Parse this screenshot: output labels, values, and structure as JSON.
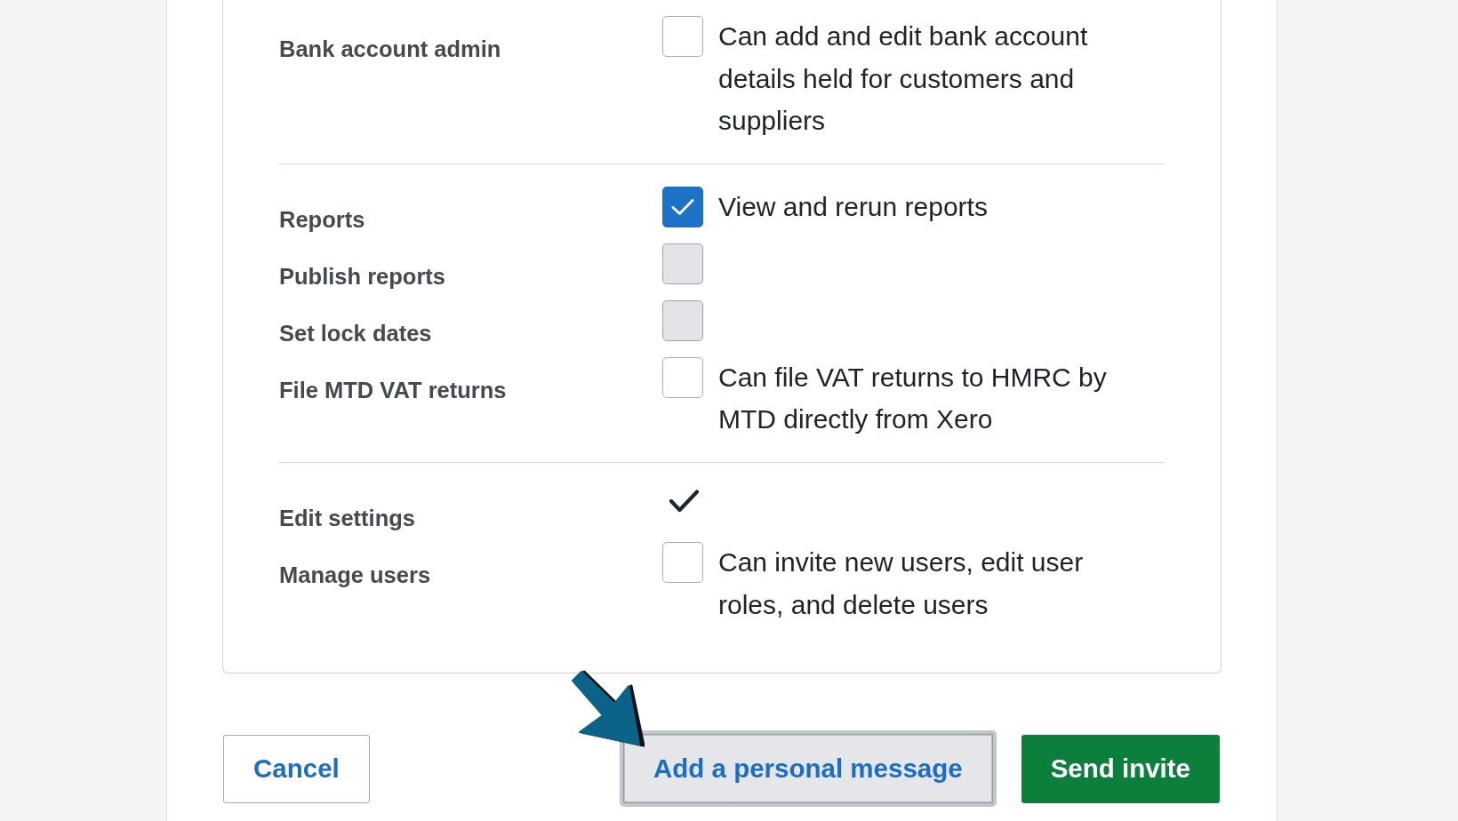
{
  "permission_groups": [
    {
      "rows": [
        {
          "label": "Bank account admin",
          "kind": "checkbox",
          "checked": false,
          "disabled": false,
          "description": "Can add and edit bank account details held for customers and suppliers"
        }
      ]
    },
    {
      "rows": [
        {
          "label": "Reports",
          "kind": "checkbox",
          "checked": true,
          "disabled": false,
          "description": "View and rerun reports"
        },
        {
          "label": "Publish reports",
          "kind": "checkbox",
          "checked": false,
          "disabled": true
        },
        {
          "label": "Set lock dates",
          "kind": "checkbox",
          "checked": false,
          "disabled": true
        },
        {
          "label": "File MTD VAT returns",
          "kind": "checkbox",
          "checked": false,
          "disabled": false,
          "description": "Can file VAT returns to HMRC by MTD directly from Xero"
        }
      ]
    },
    {
      "rows": [
        {
          "label": "Edit settings",
          "kind": "tick"
        },
        {
          "label": "Manage users",
          "kind": "checkbox",
          "checked": false,
          "disabled": false,
          "description": "Can invite new users, edit user roles, and delete users"
        }
      ]
    }
  ],
  "buttons": [
    {
      "label": "Cancel",
      "kind": "secondary",
      "focused": false
    },
    {
      "label": "Add a personal message",
      "kind": "secondary",
      "focused": true
    },
    {
      "label": "Send invite",
      "kind": "primary",
      "focused": false
    }
  ]
}
